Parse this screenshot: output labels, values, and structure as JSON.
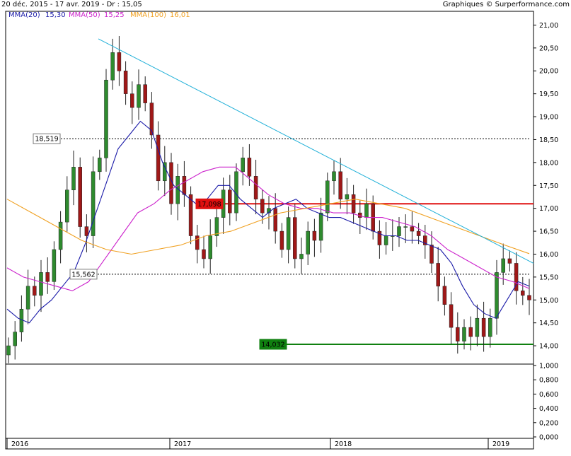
{
  "header": {
    "range_text": "20 déc. 2015 - 17 avr. 2019 - Dr : 15,05",
    "source_text": "Graphiques © Surperformance.com",
    "ma_legend": [
      {
        "label": "MMA(20)",
        "value": "15,30",
        "color": "#1a1aa8"
      },
      {
        "label": "MMA(50)",
        "value": "15,25",
        "color": "#cc22cc"
      },
      {
        "label": "MMA(100)",
        "value": "16,01",
        "color": "#f0a020"
      }
    ]
  },
  "colors": {
    "up": "#2e8b2e",
    "down": "#a01818",
    "trendline": "#20b0d8",
    "resistance": "#e01010",
    "support": "#108010"
  },
  "chart_data": {
    "type": "candlestick",
    "y_range": [
      13.6,
      21.3
    ],
    "y_ticks": [
      "21,00",
      "20,50",
      "20,00",
      "19,50",
      "19,00",
      "18,50",
      "18,00",
      "17,50",
      "17,00",
      "16,50",
      "16,00",
      "15,50",
      "15,00",
      "14,50",
      "14,00"
    ],
    "x_labels": [
      "2016",
      "2017",
      "2018",
      "2019"
    ],
    "volume_ticks": [
      "1,000",
      "0,800",
      "0,600",
      "0,400",
      "0,200",
      "0,000"
    ],
    "levels": [
      {
        "label": "18,519",
        "value": 18.519,
        "style": "dashed",
        "color": "#000000",
        "label_bg": "#ffffff",
        "label_fg": "#000000"
      },
      {
        "label": "15,562",
        "value": 15.562,
        "style": "dashed",
        "color": "#000000",
        "label_bg": "#ffffff",
        "label_fg": "#000000"
      },
      {
        "label": "17,098",
        "value": 17.098,
        "style": "solid",
        "color": "#e01010",
        "label_bg": "#e01010",
        "label_fg": "#ffffff"
      },
      {
        "label": "14,032",
        "value": 14.032,
        "style": "solid",
        "color": "#108010",
        "label_bg": "#108010",
        "label_fg": "#ffffff"
      }
    ],
    "trendline_values": [
      20.7,
      15.8
    ],
    "series_close": [
      14.0,
      14.3,
      14.8,
      15.3,
      15.1,
      15.6,
      15.4,
      16.1,
      16.7,
      17.4,
      17.9,
      16.6,
      16.4,
      17.8,
      18.1,
      19.8,
      20.4,
      20.0,
      19.5,
      19.2,
      19.7,
      19.3,
      18.6,
      17.6,
      18.0,
      17.1,
      17.7,
      17.3,
      16.4,
      16.1,
      15.9,
      16.4,
      16.8,
      17.4,
      16.9,
      17.8,
      18.1,
      17.7,
      17.2,
      16.9,
      17.0,
      16.5,
      16.1,
      16.8,
      15.9,
      16.0,
      16.5,
      16.3,
      16.9,
      17.6,
      17.8,
      17.2,
      17.3,
      16.9,
      16.8,
      17.1,
      16.5,
      16.2,
      16.4,
      16.4,
      16.6,
      16.6,
      16.5,
      16.4,
      16.2,
      15.8,
      15.3,
      14.9,
      14.4,
      14.1,
      14.4,
      14.2,
      14.6,
      14.2,
      14.6,
      15.6,
      15.9,
      15.8,
      15.2,
      15.1,
      15.0
    ],
    "series_mma20": [
      14.8,
      14.6,
      14.5,
      14.8,
      15.0,
      15.3,
      15.6,
      16.2,
      16.9,
      17.6,
      18.3,
      18.6,
      18.9,
      18.7,
      18.0,
      17.5,
      17.3,
      17.1,
      17.2,
      17.5,
      17.5,
      17.2,
      17.0,
      16.8,
      17.0,
      17.1,
      17.2,
      17.0,
      16.9,
      16.8,
      16.8,
      16.7,
      16.6,
      16.5,
      16.4,
      16.4,
      16.3,
      16.3,
      16.2,
      16.1,
      15.8,
      15.3,
      14.9,
      14.7,
      14.6,
      15.0,
      15.4,
      15.3
    ],
    "series_mma50": [
      15.7,
      15.5,
      15.4,
      15.3,
      15.2,
      15.4,
      15.9,
      16.4,
      16.9,
      17.1,
      17.4,
      17.6,
      17.8,
      17.9,
      17.9,
      17.6,
      17.3,
      17.1,
      17.0,
      17.0,
      16.9,
      16.9,
      16.8,
      16.8,
      16.7,
      16.6,
      16.4,
      16.1,
      15.9,
      15.7,
      15.5,
      15.4,
      15.25
    ],
    "series_mma100": [
      17.2,
      16.9,
      16.6,
      16.3,
      16.1,
      16.0,
      16.1,
      16.2,
      16.4,
      16.5,
      16.7,
      16.9,
      17.0,
      17.1,
      17.2,
      17.1,
      17.0,
      16.8,
      16.6,
      16.4,
      16.2,
      16.01
    ]
  }
}
